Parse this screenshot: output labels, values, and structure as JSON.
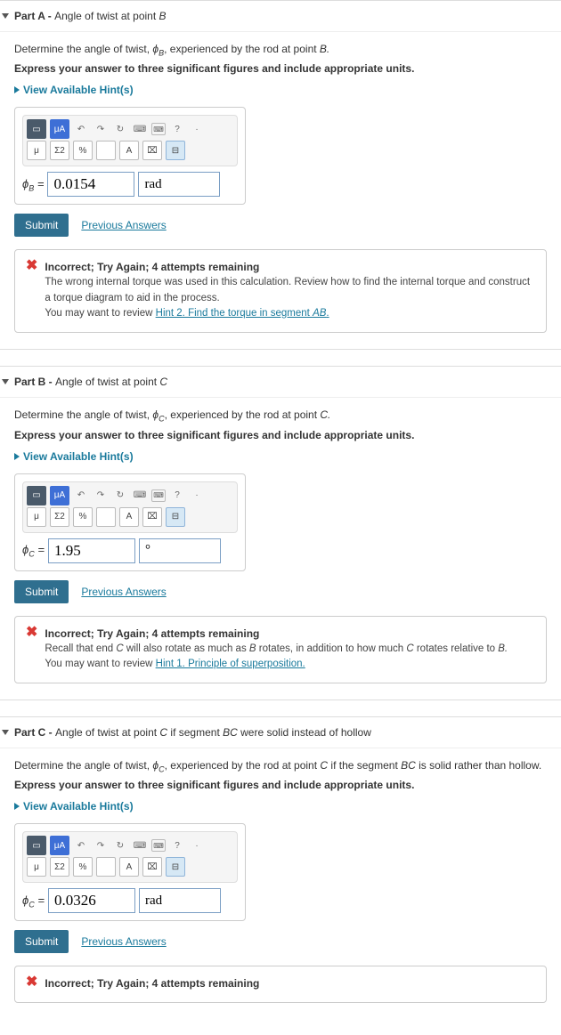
{
  "hints_label": "View Available Hint(s)",
  "submit_label": "Submit",
  "prev_answers_label": "Previous Answers",
  "instr_bold": "Express your answer to three significant figures and include appropriate units.",
  "parts": {
    "A": {
      "title_prefix": "Part A - ",
      "title_rest": "Angle of twist at point ",
      "title_point": "B",
      "prompt_pre": "Determine the angle of twist, ",
      "phi_sym": "ϕ",
      "phi_sub": "B",
      "prompt_post": ", experienced by the rod at point ",
      "prompt_point": "B.",
      "var_label_pre": "ϕ",
      "var_label_sub": "B",
      "eq": " = ",
      "value": "0.0154",
      "unit": "rad",
      "feedback": {
        "title": "Incorrect; Try Again; 4 attempts remaining",
        "line1": "The wrong internal torque was used in this calculation. Review how to find the internal torque and construct a torque diagram to aid in the process.",
        "line2_pre": "You may want to review ",
        "hint_text": "Hint 2. Find the torque in segment ",
        "hint_ital": "AB",
        "hint_post": "."
      }
    },
    "B": {
      "title_prefix": "Part B - ",
      "title_rest": "Angle of twist at point ",
      "title_point": "C",
      "prompt_pre": "Determine the angle of twist, ",
      "phi_sym": "ϕ",
      "phi_sub": "C",
      "prompt_post": ", experienced by the rod at point ",
      "prompt_point": "C.",
      "var_label_pre": "ϕ",
      "var_label_sub": "C",
      "eq": " = ",
      "value": "1.95",
      "unit": "°",
      "feedback": {
        "title": "Incorrect; Try Again; 4 attempts remaining",
        "line1_pre": "Recall that end ",
        "line1_c": "C",
        "line1_mid": " will also rotate as much as ",
        "line1_b": "B",
        "line1_mid2": " rotates, in addition to how much ",
        "line1_c2": "C",
        "line1_post": " rotates relative to ",
        "line1_b2": "B.",
        "line2_pre": "You may want to review ",
        "hint_text": "Hint 1. Principle of superposition."
      }
    },
    "C": {
      "title_prefix": "Part C - ",
      "title_rest": "Angle of twist at point ",
      "title_point": "C",
      "title_extra_pre": " if segment ",
      "title_extra_ital": "BC",
      "title_extra_post": " were solid instead of hollow",
      "prompt_pre": "Determine the angle of twist, ",
      "phi_sym": "ϕ",
      "phi_sub": "C",
      "prompt_post": ", experienced by the rod at point ",
      "prompt_point": "C",
      "prompt_extra_pre": " if the segment ",
      "prompt_extra_ital": "BC",
      "prompt_extra_post": " is solid rather than hollow.",
      "var_label_pre": "ϕ",
      "var_label_sub": "C",
      "eq": " = ",
      "value": "0.0326",
      "unit": "rad",
      "feedback": {
        "title": "Incorrect; Try Again; 4 attempts remaining"
      }
    }
  },
  "toolbar": {
    "mu": "μ",
    "frac": "μA",
    "sigma": "Σ2",
    "pct": "%",
    "A": "A",
    "undo": "↶",
    "redo": "↷",
    "reset": "↻",
    "kbd": "⌨",
    "help": "?"
  }
}
